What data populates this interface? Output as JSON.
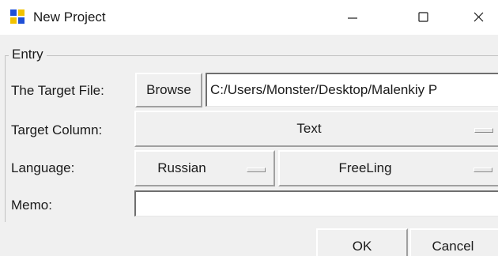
{
  "window": {
    "title": "New Project",
    "icon": "app-grid-icon",
    "controls": {
      "minimize_icon": "minimize-icon",
      "maximize_icon": "maximize-icon",
      "close_icon": "close-icon"
    }
  },
  "entry_group": {
    "legend": "Entry",
    "target_file": {
      "label": "The Target File:",
      "browse_label": "Browse",
      "value": "C:/Users/Monster/Desktop/Malenkiy P"
    },
    "target_column": {
      "label": "Target Column:",
      "selected": "Text"
    },
    "language": {
      "label": "Language:",
      "selected": "Russian",
      "analyzer_selected": "FreeLing"
    },
    "memo": {
      "label": "Memo:",
      "value": ""
    }
  },
  "actions": {
    "ok_label": "OK",
    "cancel_label": "Cancel"
  },
  "colors": {
    "icon_blue": "#1f4fd6",
    "icon_yellow": "#f2c200",
    "background": "#f0f0f0",
    "titlebar": "#ffffff"
  }
}
